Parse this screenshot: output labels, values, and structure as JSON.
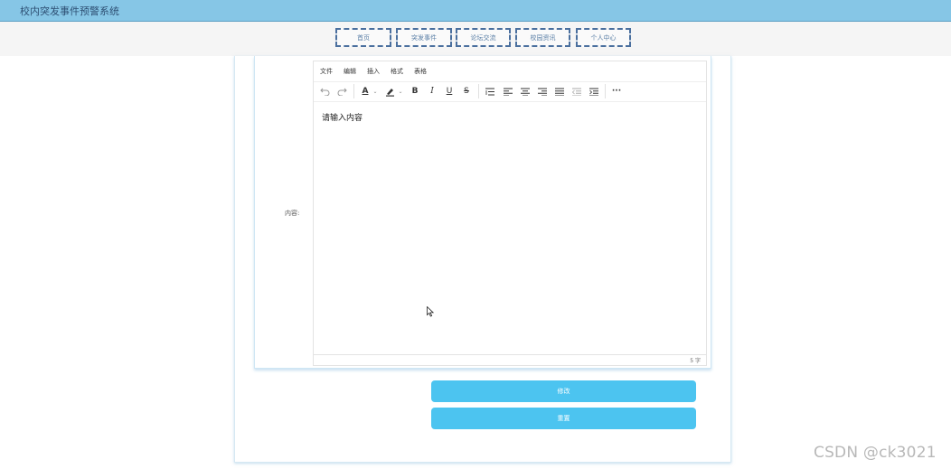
{
  "app": {
    "title": "校内突发事件预警系统"
  },
  "nav": {
    "items": [
      {
        "label": "首页"
      },
      {
        "label": "突发事件"
      },
      {
        "label": "论坛交流"
      },
      {
        "label": "校园资讯"
      },
      {
        "label": "个人中心"
      }
    ]
  },
  "form": {
    "content_label": "内容:"
  },
  "editor": {
    "menu": [
      "文件",
      "编辑",
      "插入",
      "格式",
      "表格"
    ],
    "tools": {
      "undo": "undo-icon",
      "redo": "redo-icon",
      "font_color": "A",
      "bold": "B",
      "italic": "I",
      "underline": "U",
      "strikethrough": "S",
      "more": "···"
    },
    "placeholder": "请输入内容",
    "word_count": "5 字"
  },
  "buttons": {
    "submit": "修改",
    "reset": "重置"
  },
  "watermark": "CSDN @ck3021",
  "colors": {
    "topbar": "#86c6e6",
    "button": "#4cc4f0",
    "nav_border": "#4a6f9e"
  }
}
